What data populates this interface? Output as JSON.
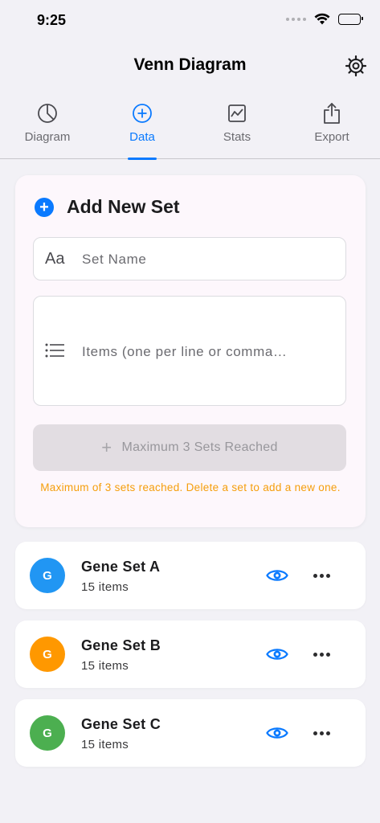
{
  "status_bar": {
    "time": "9:25"
  },
  "nav": {
    "title": "Venn Diagram",
    "settings_icon": "gear-icon"
  },
  "tabs": [
    {
      "label": "Diagram",
      "icon": "pie-chart-icon",
      "active": false
    },
    {
      "label": "Data",
      "icon": "plus-circle-icon",
      "active": true
    },
    {
      "label": "Stats",
      "icon": "line-chart-icon",
      "active": false
    },
    {
      "label": "Export",
      "icon": "share-icon",
      "active": false
    }
  ],
  "add_set": {
    "title": "Add New Set",
    "name_icon": "Aa",
    "name_placeholder": "Set Name",
    "items_placeholder": "Items (one per line or comma…",
    "button_label": "Maximum 3 Sets Reached",
    "warning": "Maximum of 3 sets reached. Delete a set to add a new one.",
    "warning_color": "#f59e0b"
  },
  "sets": [
    {
      "initial": "G",
      "name": "Gene Set A",
      "count": "15 items",
      "color": "#2196f3"
    },
    {
      "initial": "G",
      "name": "Gene Set B",
      "count": "15 items",
      "color": "#ff9800"
    },
    {
      "initial": "G",
      "name": "Gene Set C",
      "count": "15 items",
      "color": "#4caf50"
    }
  ],
  "accent_color": "#0a7aff"
}
